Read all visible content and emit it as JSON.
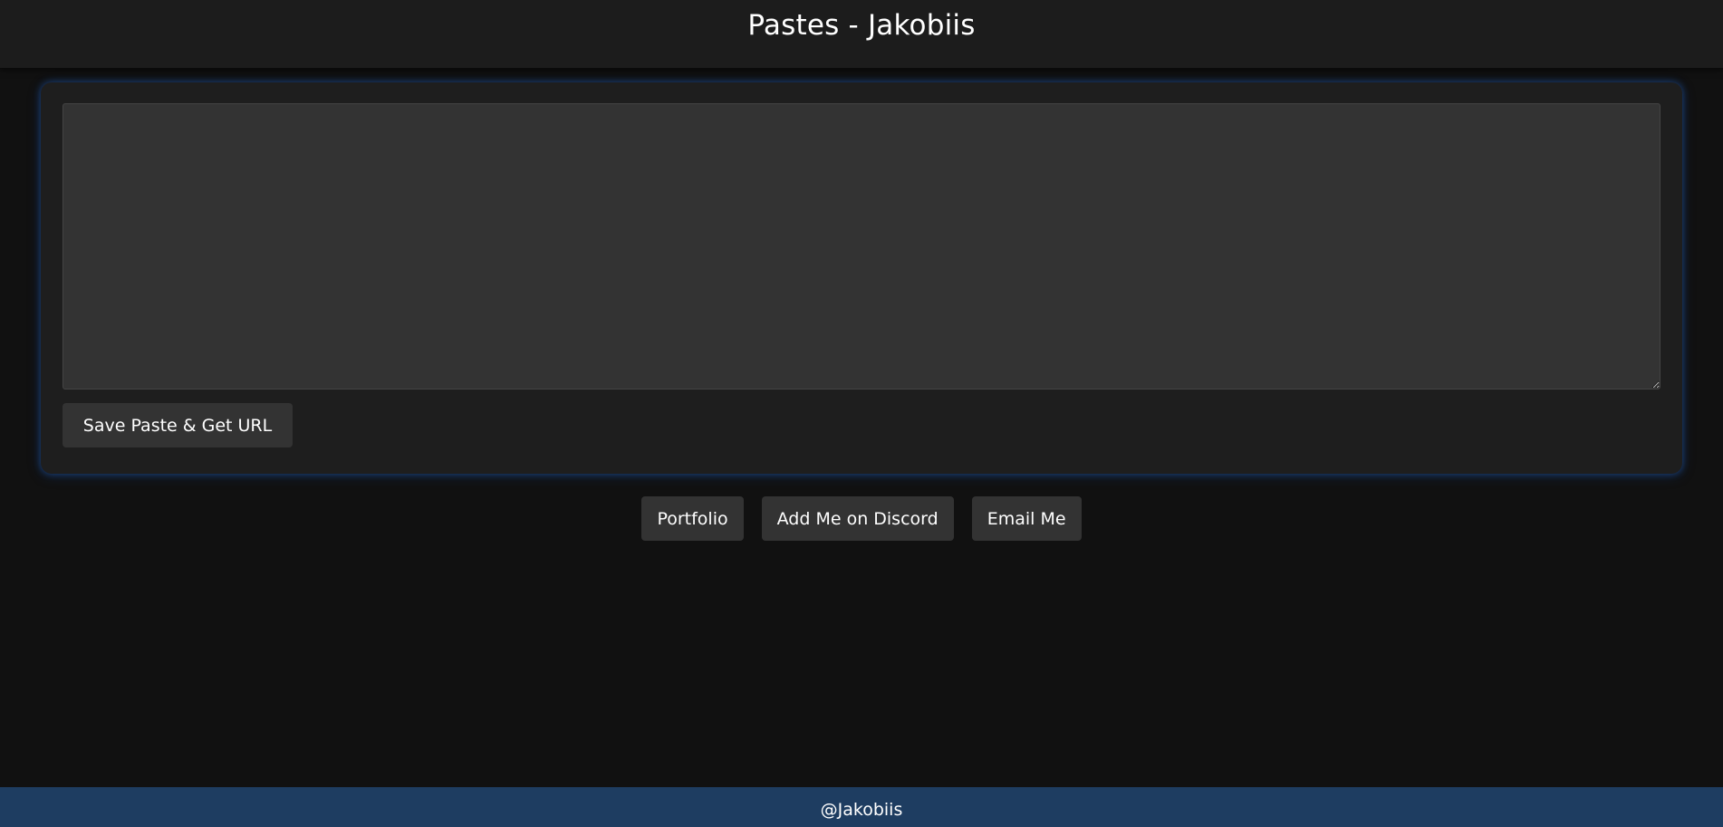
{
  "header": {
    "title": "Pastes - Jakobiis"
  },
  "editor": {
    "value": "",
    "placeholder": ""
  },
  "actions": {
    "save_label": "Save Paste & Get URL"
  },
  "links": [
    {
      "label": "Portfolio"
    },
    {
      "label": "Add Me on Discord"
    },
    {
      "label": "Email Me"
    }
  ],
  "footer": {
    "text": "@Jakobiis"
  },
  "colors": {
    "background": "#111111",
    "header": "#1c1c1c",
    "panel": "#1e1e1e",
    "input": "#333333",
    "button": "#333333",
    "panel_glow": "#235fb9",
    "footer": "#1e3d61",
    "text": "#ffffff"
  }
}
